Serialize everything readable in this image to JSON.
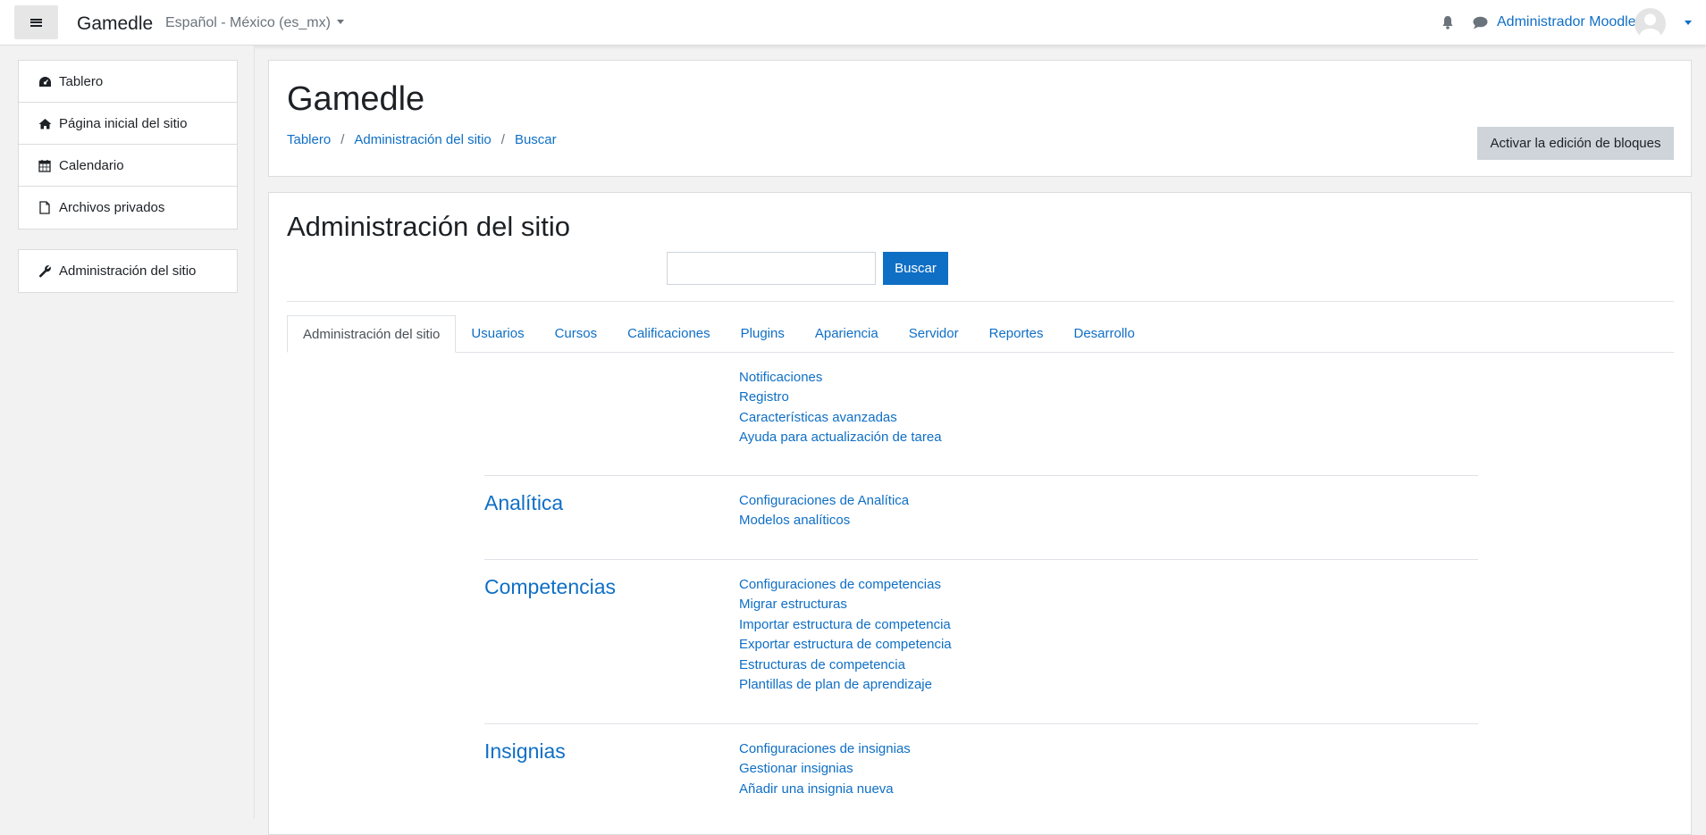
{
  "navbar": {
    "brand": "Gamedle",
    "language": "Español - México (es_mx)",
    "user_name": "Administrador Moodle",
    "icons": [
      "hamburger-icon",
      "bell-icon",
      "chat-icon",
      "avatar"
    ]
  },
  "drawer": {
    "group1": [
      {
        "label": "Tablero",
        "icon": "dashboard-icon"
      },
      {
        "label": "Página inicial del sitio",
        "icon": "home-icon"
      },
      {
        "label": "Calendario",
        "icon": "calendar-icon"
      },
      {
        "label": "Archivos privados",
        "icon": "file-icon"
      }
    ],
    "group2": [
      {
        "label": "Administración del sitio",
        "icon": "wrench-icon"
      }
    ]
  },
  "header": {
    "title": "Gamedle",
    "breadcrumb": [
      "Tablero",
      "Administración del sitio",
      "Buscar"
    ],
    "edit_button": "Activar la edición de bloques"
  },
  "main": {
    "heading": "Administración del sitio",
    "search_button": "Buscar",
    "tabs": [
      "Administración del sitio",
      "Usuarios",
      "Cursos",
      "Calificaciones",
      "Plugins",
      "Apariencia",
      "Servidor",
      "Reportes",
      "Desarrollo"
    ],
    "active_tab": "Administración del sitio",
    "top_links": [
      "Notificaciones",
      "Registro",
      "Características avanzadas",
      "Ayuda para actualización de tarea"
    ],
    "sections": [
      {
        "title": "Analítica",
        "links": [
          "Configuraciones de Analítica",
          "Modelos analíticos"
        ]
      },
      {
        "title": "Competencias",
        "links": [
          "Configuraciones de competencias",
          "Migrar estructuras",
          "Importar estructura de competencia",
          "Exportar estructura de competencia",
          "Estructuras de competencia",
          "Plantillas de plan de aprendizaje"
        ]
      },
      {
        "title": "Insignias",
        "links": [
          "Configuraciones de insignias",
          "Gestionar insignias",
          "Añadir una insignia nueva"
        ]
      }
    ]
  },
  "colors": {
    "link": "#0f6fc5",
    "primary_button": "#0f6fc5",
    "secondary_button": "#ced4da",
    "background": "#f2f2f2"
  }
}
